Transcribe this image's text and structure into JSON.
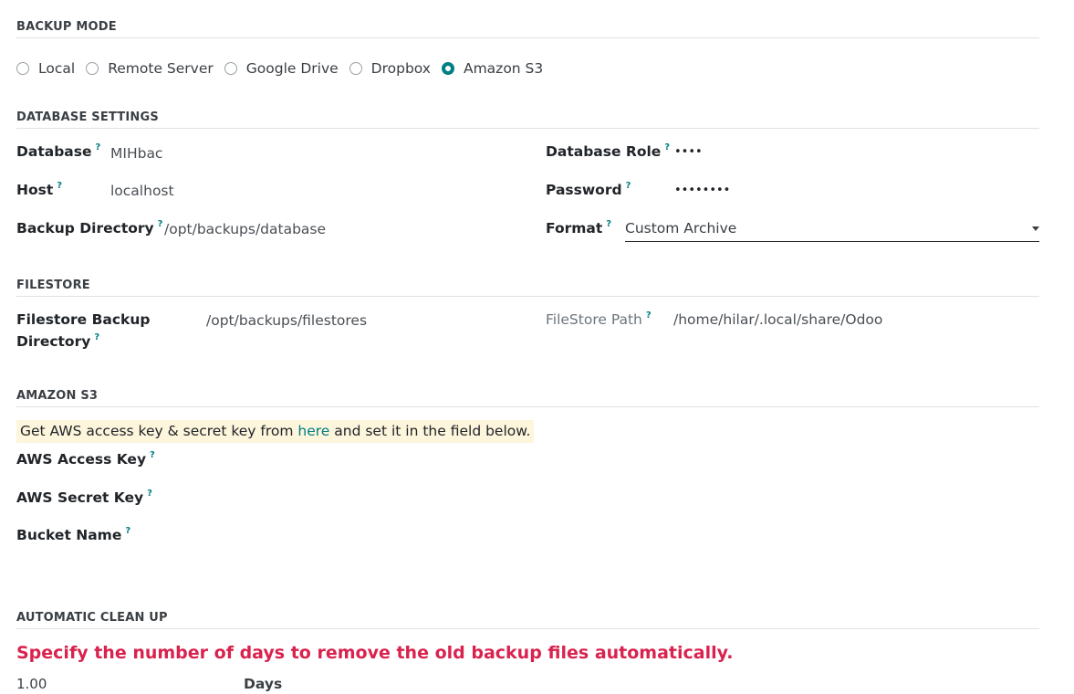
{
  "backup_mode": {
    "title": "BACKUP MODE",
    "options": [
      {
        "label": "Local",
        "selected": false
      },
      {
        "label": "Remote Server",
        "selected": false
      },
      {
        "label": "Google Drive",
        "selected": false
      },
      {
        "label": "Dropbox",
        "selected": false
      },
      {
        "label": "Amazon S3",
        "selected": true
      }
    ]
  },
  "database_settings": {
    "title": "DATABASE SETTINGS",
    "database": {
      "label": "Database",
      "value": "MIHbac"
    },
    "host": {
      "label": "Host",
      "value": "localhost"
    },
    "backup_directory": {
      "label": "Backup Directory",
      "value": "/opt/backups/database"
    },
    "database_role": {
      "label": "Database Role",
      "value": "••••"
    },
    "password": {
      "label": "Password",
      "value": "••••••••"
    },
    "format": {
      "label": "Format",
      "value": "Custom Archive"
    }
  },
  "filestore": {
    "title": "FILESTORE",
    "backup_directory_label_line1": "Filestore Backup",
    "backup_directory_label_line2": "Directory",
    "backup_directory_value": "/opt/backups/filestores",
    "path": {
      "label": "FileStore Path",
      "value": "/home/hilar/.local/share/Odoo"
    }
  },
  "amazon_s3": {
    "title": "AMAZON S3",
    "notice_before": "Get AWS access key & secret key from ",
    "notice_link": "here",
    "notice_after": " and set it in the field below.",
    "access_key_label": "AWS Access Key",
    "secret_key_label": "AWS Secret Key",
    "bucket_name_label": "Bucket Name"
  },
  "cleanup": {
    "title": "AUTOMATIC CLEAN UP",
    "warning": "Specify the number of days to remove the old backup files automatically.",
    "days_value": "1.00",
    "days_label": "Days"
  },
  "help_marker": "?",
  "colors": {
    "accent": "#017e84",
    "warning": "#d9224e",
    "notice_bg": "#fdf5dc"
  }
}
